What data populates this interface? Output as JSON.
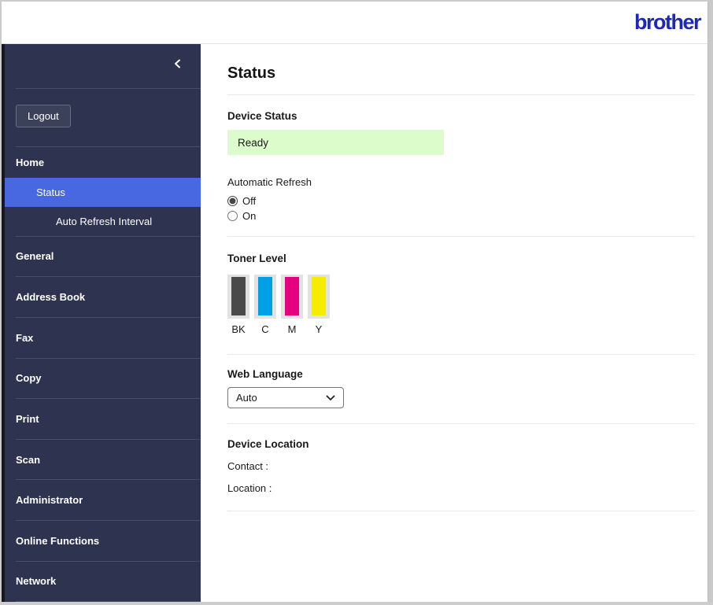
{
  "header": {
    "logo_text": "brother",
    "logo_color": "#1e28b8"
  },
  "sidebar": {
    "background": "#2e3450",
    "selected_color": "#4768e0",
    "logout_label": "Logout",
    "items": [
      {
        "label": "Home",
        "level": 0,
        "selected": false
      },
      {
        "label": "Status",
        "level": 1,
        "selected": true
      },
      {
        "label": "Auto Refresh Interval",
        "level": 2,
        "selected": false
      },
      {
        "label": "General",
        "level": 0,
        "selected": false
      },
      {
        "label": "Address Book",
        "level": 0,
        "selected": false
      },
      {
        "label": "Fax",
        "level": 0,
        "selected": false
      },
      {
        "label": "Copy",
        "level": 0,
        "selected": false
      },
      {
        "label": "Print",
        "level": 0,
        "selected": false
      },
      {
        "label": "Scan",
        "level": 0,
        "selected": false
      },
      {
        "label": "Administrator",
        "level": 0,
        "selected": false
      },
      {
        "label": "Online Functions",
        "level": 0,
        "selected": false
      },
      {
        "label": "Network",
        "level": 0,
        "selected": false
      }
    ]
  },
  "main": {
    "title": "Status",
    "device_status": {
      "label": "Device Status",
      "value": "Ready",
      "value_bg": "#dcfccb"
    },
    "automatic_refresh": {
      "label": "Automatic Refresh",
      "options": [
        {
          "label": "Off",
          "selected": true
        },
        {
          "label": "On",
          "selected": false
        }
      ]
    },
    "toner_level": {
      "label": "Toner Level",
      "cartridges": [
        {
          "label": "BK",
          "color": "#4a4a4a"
        },
        {
          "label": "C",
          "color": "#00a0e4"
        },
        {
          "label": "M",
          "color": "#e4007e"
        },
        {
          "label": "Y",
          "color": "#f5ec00"
        }
      ]
    },
    "web_language": {
      "label": "Web Language",
      "selected_option": "Auto"
    },
    "device_location": {
      "label": "Device Location",
      "contact_label": "Contact :",
      "location_label": "Location :"
    }
  }
}
